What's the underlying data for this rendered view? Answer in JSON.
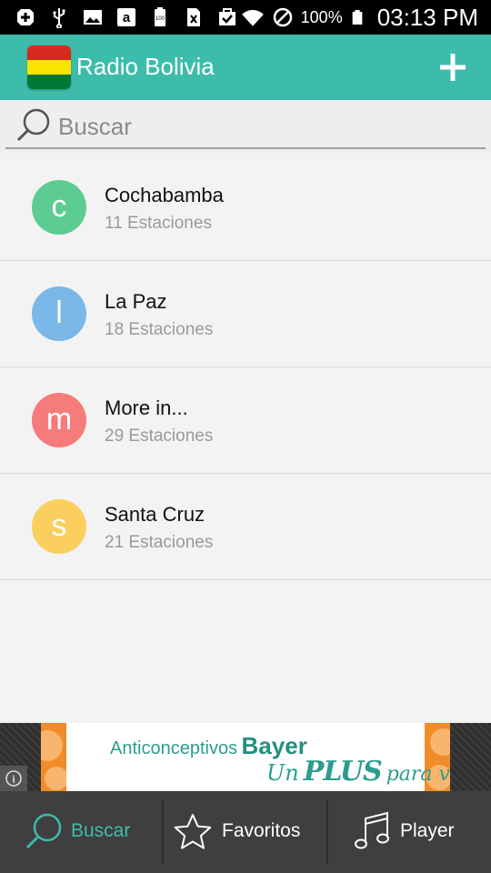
{
  "status_bar": {
    "battery_percent": "100%",
    "time": "03:13 PM",
    "left_icons": [
      "plus-box-icon",
      "usb-icon",
      "image-icon",
      "amazon-icon",
      "battery-saver-icon",
      "sim-icon",
      "clipboard-check-icon"
    ],
    "right_icons": [
      "wifi-icon",
      "no-sound-icon",
      "battery-icon"
    ]
  },
  "app_bar": {
    "title": "Radio Bolivia",
    "flag_colors": [
      "#d52b1e",
      "#f9e300",
      "#007934"
    ],
    "background": "#3dbcab"
  },
  "search": {
    "placeholder": "Buscar",
    "value": ""
  },
  "list": {
    "items": [
      {
        "letter": "c",
        "name": "Cochabamba",
        "subtitle": "11 Estaciones",
        "color": "#5ccc92"
      },
      {
        "letter": "l",
        "name": "La Paz",
        "subtitle": "18 Estaciones",
        "color": "#79b8e8"
      },
      {
        "letter": "m",
        "name": "More in...",
        "subtitle": "29 Estaciones",
        "color": "#f67b7b"
      },
      {
        "letter": "s",
        "name": "Santa Cruz",
        "subtitle": "21 Estaciones",
        "color": "#fbcf5e"
      }
    ]
  },
  "ad": {
    "line1_part1": "Anticonceptivos",
    "line1_part2": "Bayer",
    "line2_part1": "Un",
    "line2_part2": "PLUS",
    "line2_part3": "para vos.",
    "info_glyph": "i"
  },
  "bottom_nav": {
    "tabs": [
      {
        "label": "Buscar",
        "icon": "search-icon",
        "color": "#3dbcab"
      },
      {
        "label": "Favoritos",
        "icon": "star-icon",
        "color": "#ffffff"
      },
      {
        "label": "Player",
        "icon": "music-note-icon",
        "color": "#ffffff"
      }
    ]
  }
}
